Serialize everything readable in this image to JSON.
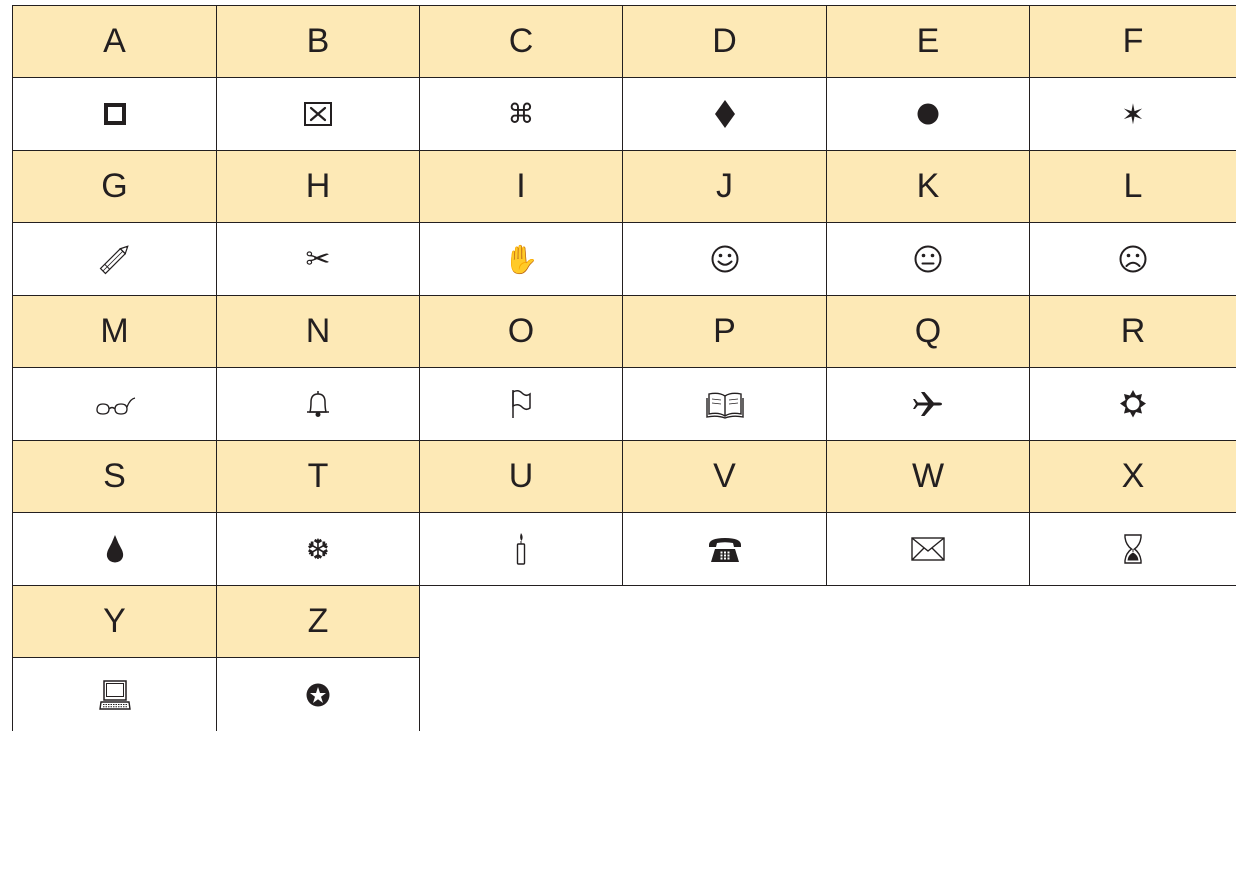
{
  "table": {
    "cells": [
      {
        "letter": "A",
        "symbol_icon": "hollow-square-icon"
      },
      {
        "letter": "B",
        "symbol_icon": "boxed-x-icon"
      },
      {
        "letter": "C",
        "symbol_icon": "command-key-icon"
      },
      {
        "letter": "D",
        "symbol_icon": "diamond-icon"
      },
      {
        "letter": "E",
        "symbol_icon": "filled-circle-icon"
      },
      {
        "letter": "F",
        "symbol_icon": "six-point-star-icon"
      },
      {
        "letter": "G",
        "symbol_icon": "pencil-icon"
      },
      {
        "letter": "H",
        "symbol_icon": "scissors-icon"
      },
      {
        "letter": "I",
        "symbol_icon": "hand-icon"
      },
      {
        "letter": "J",
        "symbol_icon": "smiley-face-icon"
      },
      {
        "letter": "K",
        "symbol_icon": "neutral-face-icon"
      },
      {
        "letter": "L",
        "symbol_icon": "frowning-face-icon"
      },
      {
        "letter": "M",
        "symbol_icon": "eyeglasses-icon"
      },
      {
        "letter": "N",
        "symbol_icon": "bell-icon"
      },
      {
        "letter": "O",
        "symbol_icon": "flag-icon"
      },
      {
        "letter": "P",
        "symbol_icon": "open-book-icon"
      },
      {
        "letter": "Q",
        "symbol_icon": "airplane-icon"
      },
      {
        "letter": "R",
        "symbol_icon": "sun-icon"
      },
      {
        "letter": "S",
        "symbol_icon": "droplet-icon"
      },
      {
        "letter": "T",
        "symbol_icon": "snowflake-icon"
      },
      {
        "letter": "U",
        "symbol_icon": "candle-icon"
      },
      {
        "letter": "V",
        "symbol_icon": "telephone-icon"
      },
      {
        "letter": "W",
        "symbol_icon": "envelope-icon"
      },
      {
        "letter": "X",
        "symbol_icon": "hourglass-icon"
      },
      {
        "letter": "Y",
        "symbol_icon": "computer-icon"
      },
      {
        "letter": "Z",
        "symbol_icon": "star-in-circle-icon"
      }
    ]
  },
  "colors": {
    "letter_row_background": "#fde9b6",
    "symbol_row_background": "#ffffff",
    "border": "#231f20",
    "ink": "#231f20"
  }
}
